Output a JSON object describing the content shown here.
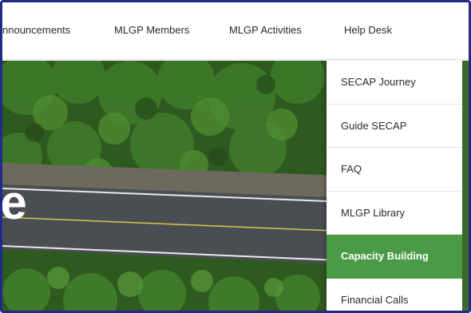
{
  "nav": {
    "items": [
      {
        "label": "nnouncements"
      },
      {
        "label": "MLGP Members"
      },
      {
        "label": "MLGP Activities"
      },
      {
        "label": "Help Desk"
      }
    ]
  },
  "hero": {
    "headline": "ate"
  },
  "dropdown": {
    "items": [
      {
        "label": "SECAP Journey"
      },
      {
        "label": "Guide SECAP"
      },
      {
        "label": "FAQ"
      },
      {
        "label": "MLGP Library"
      },
      {
        "label": "Capacity Building",
        "active": true
      },
      {
        "label": "Financial Calls"
      }
    ]
  },
  "colors": {
    "frame_border": "#1f2a8a",
    "accent_green": "#4b9a45",
    "road_asphalt": "#4a4d52",
    "forest_green": "#2f5a1f"
  }
}
